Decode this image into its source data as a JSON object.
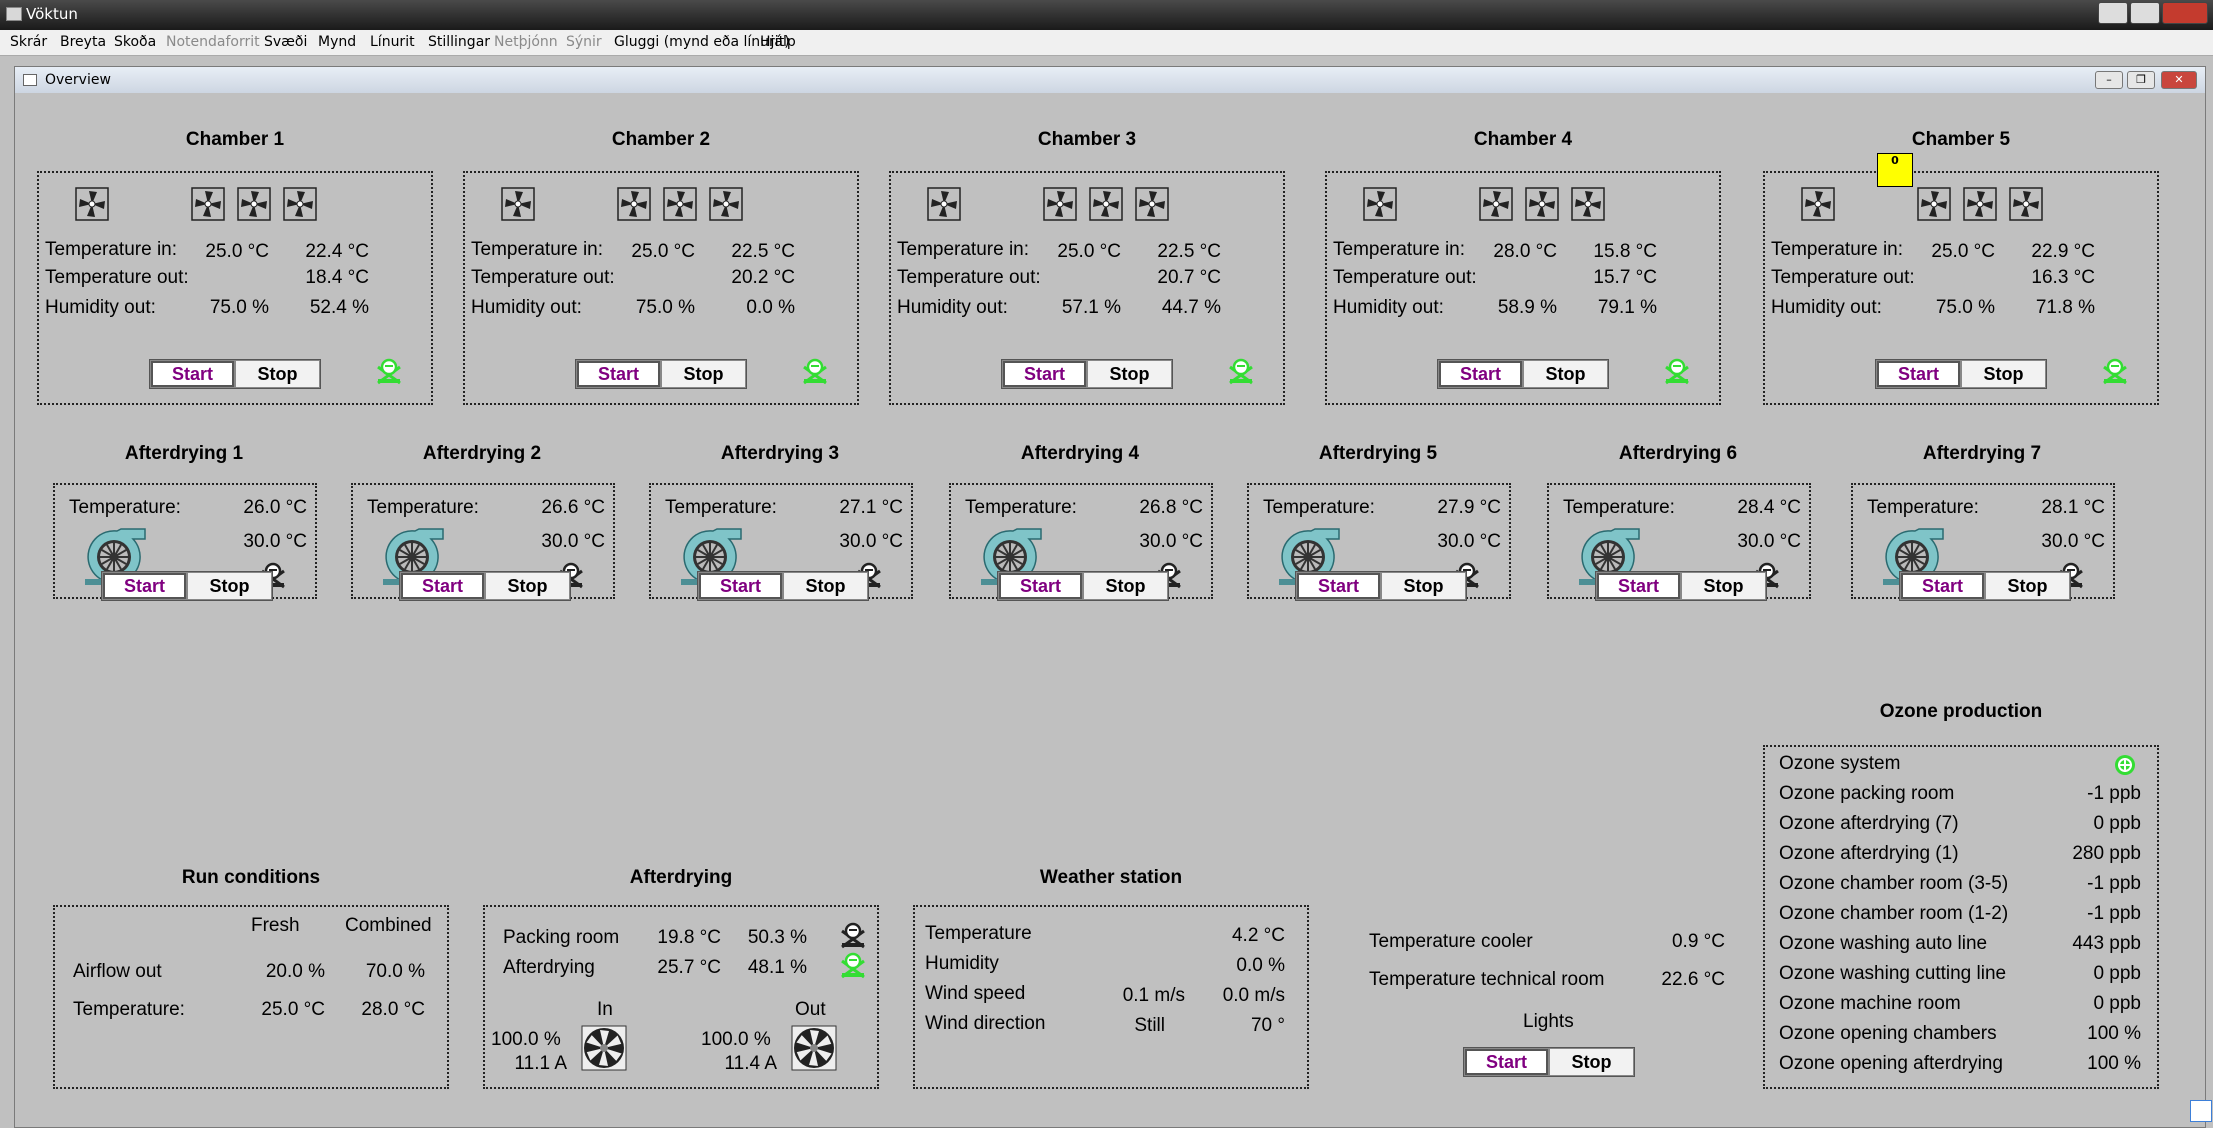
{
  "window": {
    "title": "Vöktun"
  },
  "menu": [
    "Skrár",
    "Breyta",
    "Skoða",
    "Notendaforrit",
    "Svæði",
    "Mynd",
    "Línurit",
    "Stillingar",
    "Netþjónn",
    "Sýnir",
    "Gluggi (mynd eða línurit)",
    "Hjálp"
  ],
  "menu_disabled": [
    "Notendaforrit",
    "Netþjónn",
    "Sýnir"
  ],
  "child": {
    "title": "Overview"
  },
  "chambers": [
    {
      "title": "Chamber 1",
      "temp_in_label": "Temperature in:",
      "temp_out_label": "Temperature out:",
      "hum_label": "Humidity out:",
      "temp_in_set": "25.0 °C",
      "temp_in": "22.4 °C",
      "temp_out": "18.4 °C",
      "hum_set": "75.0 %",
      "hum": "52.4 %",
      "start": "Start",
      "stop": "Stop"
    },
    {
      "title": "Chamber 2",
      "temp_in_label": "Temperature in:",
      "temp_out_label": "Temperature out:",
      "hum_label": "Humidity out:",
      "temp_in_set": "25.0 °C",
      "temp_in": "22.5 °C",
      "temp_out": "20.2 °C",
      "hum_set": "75.0 %",
      "hum": "0.0 %",
      "start": "Start",
      "stop": "Stop"
    },
    {
      "title": "Chamber 3",
      "temp_in_label": "Temperature in:",
      "temp_out_label": "Temperature out:",
      "hum_label": "Humidity out:",
      "temp_in_set": "25.0 °C",
      "temp_in": "22.5 °C",
      "temp_out": "20.7 °C",
      "hum_set": "57.1 %",
      "hum": "44.7 %",
      "start": "Start",
      "stop": "Stop"
    },
    {
      "title": "Chamber 4",
      "temp_in_label": "Temperature in:",
      "temp_out_label": "Temperature out:",
      "hum_label": "Humidity out:",
      "temp_in_set": "28.0 °C",
      "temp_in": "15.8 °C",
      "temp_out": "15.7 °C",
      "hum_set": "58.9 %",
      "hum": "79.1 %",
      "start": "Start",
      "stop": "Stop"
    },
    {
      "title": "Chamber 5",
      "temp_in_label": "Temperature in:",
      "temp_out_label": "Temperature out:",
      "hum_label": "Humidity out:",
      "temp_in_set": "25.0 °C",
      "temp_in": "22.9 °C",
      "temp_out": "16.3 °C",
      "hum_set": "75.0 %",
      "hum": "71.8 %",
      "start": "Start",
      "stop": "Stop",
      "badge": "0"
    }
  ],
  "afterdrying_units": [
    {
      "title": "Afterdrying 1",
      "label": "Temperature:",
      "temp": "26.0 °C",
      "set": "30.0 °C",
      "start": "Start",
      "stop": "Stop"
    },
    {
      "title": "Afterdrying 2",
      "label": "Temperature:",
      "temp": "26.6 °C",
      "set": "30.0 °C",
      "start": "Start",
      "stop": "Stop"
    },
    {
      "title": "Afterdrying 3",
      "label": "Temperature:",
      "temp": "27.1 °C",
      "set": "30.0 °C",
      "start": "Start",
      "stop": "Stop"
    },
    {
      "title": "Afterdrying 4",
      "label": "Temperature:",
      "temp": "26.8 °C",
      "set": "30.0 °C",
      "start": "Start",
      "stop": "Stop"
    },
    {
      "title": "Afterdrying 5",
      "label": "Temperature:",
      "temp": "27.9 °C",
      "set": "30.0 °C",
      "start": "Start",
      "stop": "Stop"
    },
    {
      "title": "Afterdrying 6",
      "label": "Temperature:",
      "temp": "28.4 °C",
      "set": "30.0 °C",
      "start": "Start",
      "stop": "Stop"
    },
    {
      "title": "Afterdrying 7",
      "label": "Temperature:",
      "temp": "28.1 °C",
      "set": "30.0 °C",
      "start": "Start",
      "stop": "Stop"
    }
  ],
  "run_conditions": {
    "title": "Run conditions",
    "col_fresh": "Fresh",
    "col_combined": "Combined",
    "airflow_label": "Airflow out",
    "airflow_fresh": "20.0 %",
    "airflow_combined": "70.0 %",
    "temp_label": "Temperature:",
    "temp_fresh": "25.0 °C",
    "temp_combined": "28.0 °C"
  },
  "afterdrying": {
    "title": "Afterdrying",
    "packing_label": "Packing room",
    "packing_temp": "19.8 °C",
    "packing_hum": "50.3 %",
    "ad_label": "Afterdrying",
    "ad_temp": "25.7 °C",
    "ad_hum": "48.1 %",
    "in_label": "In",
    "out_label": "Out",
    "in_pct": "100.0 %",
    "in_amp": "11.1 A",
    "out_pct": "100.0 %",
    "out_amp": "11.4 A"
  },
  "weather": {
    "title": "Weather station",
    "temp_label": "Temperature",
    "temp": "4.2 °C",
    "hum_label": "Humidity",
    "hum": "0.0 %",
    "wind_label": "Wind speed",
    "wind1": "0.1 m/s",
    "wind2": "0.0 m/s",
    "dir_label": "Wind direction",
    "dir1": "Still",
    "dir2": "70 °"
  },
  "misc": {
    "cooler_label": "Temperature cooler",
    "cooler": "0.9 °C",
    "tech_label": "Temperature technical room",
    "tech": "22.6 °C",
    "lights_label": "Lights",
    "start": "Start",
    "stop": "Stop"
  },
  "ozone": {
    "title": "Ozone production",
    "system_label": "Ozone system",
    "rows": [
      {
        "label": "Ozone packing room",
        "value": "-1 ppb"
      },
      {
        "label": "Ozone afterdrying (7)",
        "value": "0 ppb"
      },
      {
        "label": "Ozone afterdrying (1)",
        "value": "280 ppb"
      },
      {
        "label": "Ozone chamber room (3-5)",
        "value": "-1 ppb"
      },
      {
        "label": "Ozone chamber room (1-2)",
        "value": "-1 ppb"
      },
      {
        "label": "Ozone washing auto line",
        "value": "443 ppb"
      },
      {
        "label": "Ozone washing cutting line",
        "value": "0 ppb"
      },
      {
        "label": "Ozone machine room",
        "value": "0 ppb"
      },
      {
        "label": "Ozone opening chambers",
        "value": "100 %"
      },
      {
        "label": "Ozone opening afterdrying",
        "value": "100 %"
      }
    ]
  },
  "colors": {
    "status_on": "#33dd33",
    "status_off": "#222222",
    "start_text": "#800080",
    "badge": "#ffff00"
  }
}
